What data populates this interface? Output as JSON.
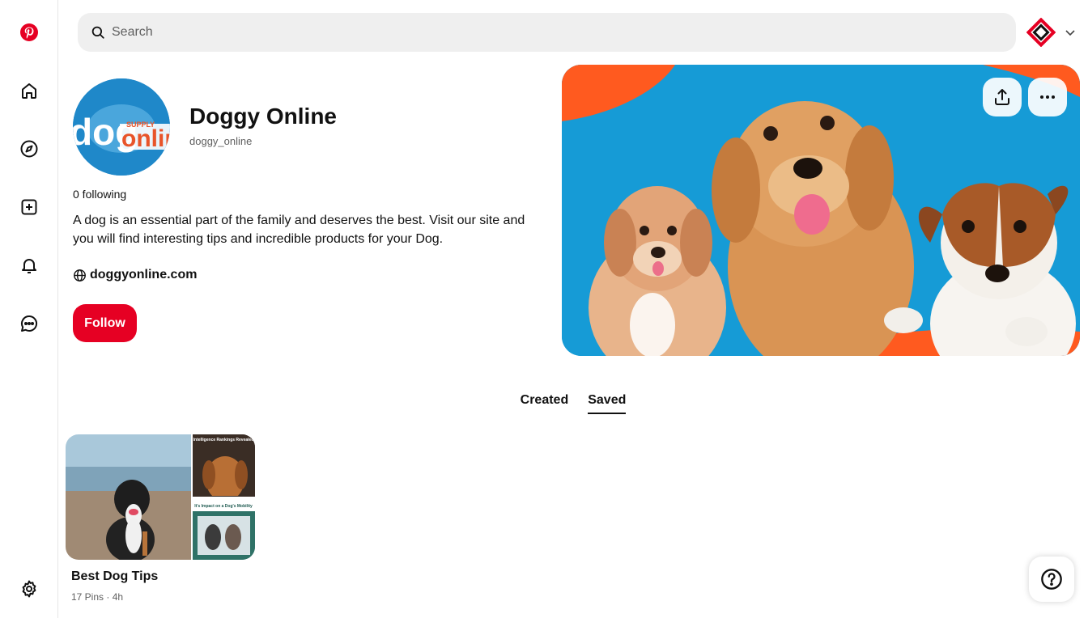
{
  "colors": {
    "brand": "#e60023",
    "cover_bg": "#169bd6",
    "cover_accent": "#ff5a1f"
  },
  "nav": {
    "items": [
      {
        "icon": "pinterest-logo-icon"
      },
      {
        "icon": "home-icon"
      },
      {
        "icon": "explore-icon"
      },
      {
        "icon": "create-icon"
      },
      {
        "icon": "notifications-icon"
      },
      {
        "icon": "messages-icon"
      },
      {
        "icon": "settings-icon"
      }
    ]
  },
  "search": {
    "placeholder": "Search"
  },
  "profile": {
    "name": "Doggy Online",
    "handle": "doggy_online",
    "avatar_text": "dog",
    "avatar_text2": "onlin",
    "avatar_text_small": "SUPPLY",
    "following": "0 following",
    "bio": "A dog is an essential part of the family and deserves the best. Visit our site and you will find interesting tips and incredible products for your Dog.",
    "website": "doggyonline.com",
    "follow_label": "Follow"
  },
  "tabs": [
    {
      "label": "Created",
      "active": false
    },
    {
      "label": "Saved",
      "active": true
    }
  ],
  "boards": [
    {
      "title": "Best Dog Tips",
      "meta": "17 Pins · 4h",
      "thumb1_text": "Intelligence Rankings Revealed",
      "thumb2_text": "It's Impact on a Dog's Mobility"
    }
  ]
}
